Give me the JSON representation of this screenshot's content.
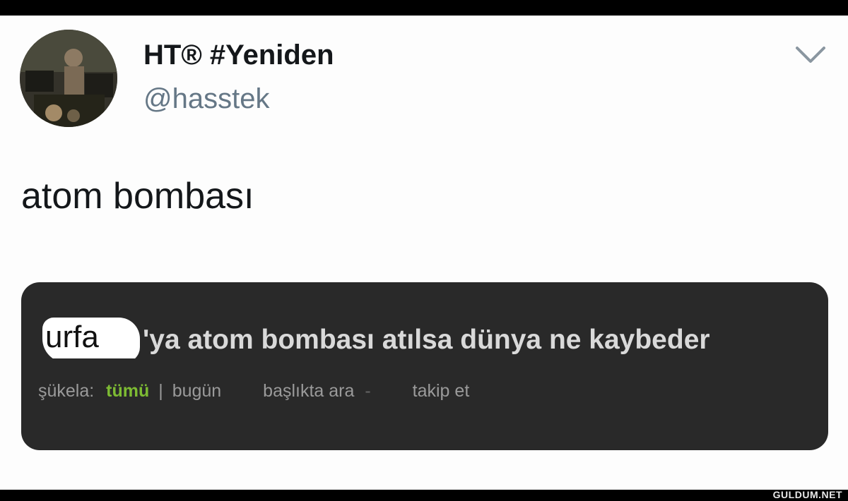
{
  "tweet": {
    "display_name": "HT® #Yeniden",
    "handle": "@hasstek",
    "text": "atom bombası",
    "icons": {
      "avatar": "profile-photo",
      "menu": "chevron-down-icon"
    }
  },
  "card": {
    "title_redacted": "urfa",
    "title_rest": "'ya atom bombası atılsa dünya ne kaybeder",
    "meta": {
      "sukela_label": "şükela:",
      "tumu": "tümü",
      "separator": "|",
      "bugun": "bugün",
      "search": "başlıkta ara",
      "search_dash": "-",
      "follow": "takip et"
    },
    "colors": {
      "background": "#292929",
      "accent": "#7dbb33"
    }
  },
  "watermark": "GULDUM.NET"
}
